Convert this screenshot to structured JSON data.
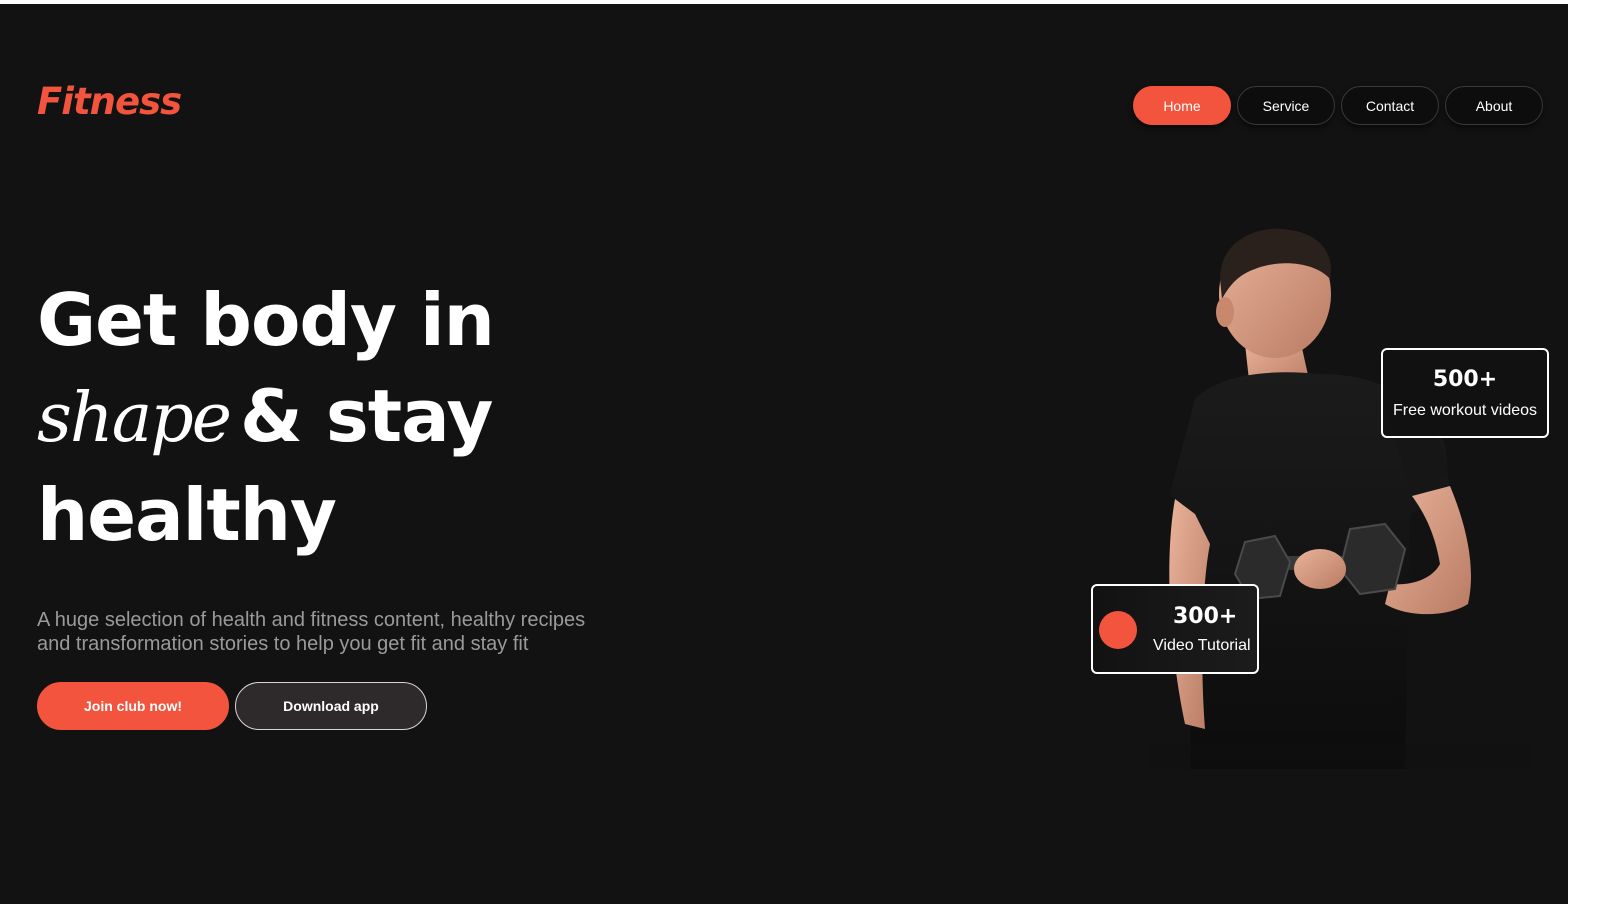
{
  "brand": {
    "logo": "Fitness",
    "accent_color": "#f2543d"
  },
  "nav": {
    "items": [
      {
        "label": "Home",
        "active": true
      },
      {
        "label": "Service",
        "active": false
      },
      {
        "label": "Contact",
        "active": false
      },
      {
        "label": "About",
        "active": false
      }
    ]
  },
  "hero": {
    "line1": "Get body in",
    "line2_script": "shape",
    "line2_rest": "& stay",
    "line3": "healthy",
    "subtitle_line1": "A huge selection of health and fitness content, healthy recipes",
    "subtitle_line2": "and transformation stories to help you get fit and stay fit",
    "primary_cta": "Join club now!",
    "secondary_cta": "Download app"
  },
  "stats": {
    "workouts": {
      "value": "500+",
      "label": "Free workout videos"
    },
    "tutorials": {
      "value": "300+",
      "label": "Video Tutorial"
    }
  },
  "image": {
    "icon": "athlete-photo"
  }
}
